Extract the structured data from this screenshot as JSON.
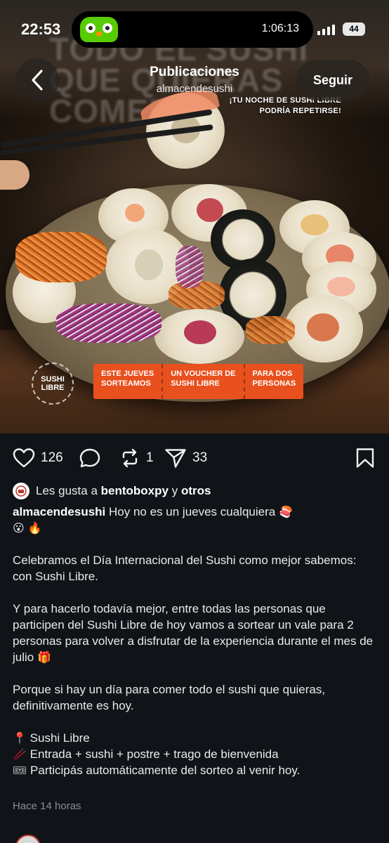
{
  "status_bar": {
    "time": "22:53",
    "activity_timer": "1:06:13",
    "battery_level": "44"
  },
  "header": {
    "title": "Publicaciones",
    "username": "almacendesushi",
    "follow_label": "Seguir"
  },
  "post_image": {
    "headline_text": "TODO EL SUSHI QUE QUIERAS COMER",
    "promo_line_1": "¡TU NOCHE DE SUSHI LIBRE",
    "promo_line_2": "PODRÍA REPETIRSE!",
    "brand_badge": "SUSHI LIBRE",
    "banner": [
      {
        "line1": "ESTE JUEVES",
        "line2": "SORTEAMOS"
      },
      {
        "line1": "UN VOUCHER DE",
        "line2": "SUSHI LIBRE"
      },
      {
        "line1": "PARA DOS",
        "line2": "PERSONAS"
      }
    ]
  },
  "actions": {
    "likes": "126",
    "comments": "",
    "reposts": "1",
    "shares": "33"
  },
  "liked_by": {
    "prefix": "Les gusta a",
    "user": "bentoboxpy",
    "connector": "y",
    "others": "otros"
  },
  "caption": {
    "username": "almacendesushi",
    "first_line": "Hoy no es un jueves cualquiera",
    "first_line_emojis": "🍣",
    "second_line_emojis": "😮 🔥",
    "paragraph_2": "Celebramos el Día Internacional del Sushi como mejor sabemos: con Sushi Libre.",
    "paragraph_3": "Y para hacerlo todavía mejor, entre todas las personas que participen del Sushi Libre de hoy vamos a sortear un vale para 2 personas para volver a disfrutar de la experiencia durante el mes de julio",
    "paragraph_3_emoji": "🎁",
    "paragraph_4": "Porque si hay un día para comer todo el sushi que quieras, definitivamente es hoy.",
    "list": [
      {
        "emoji": "📍",
        "text": "Sushi Libre"
      },
      {
        "emoji": "🥢",
        "text": "Entrada + sushi + postre + trago de bienvenida"
      },
      {
        "emoji": "🎟",
        "text": "Participás automáticamente del sorteo al venir hoy."
      }
    ]
  },
  "timestamp": "Hace 14 horas",
  "colors": {
    "background": "#101418",
    "banner_orange": "#e8501e",
    "duolingo_green": "#58cc02"
  }
}
